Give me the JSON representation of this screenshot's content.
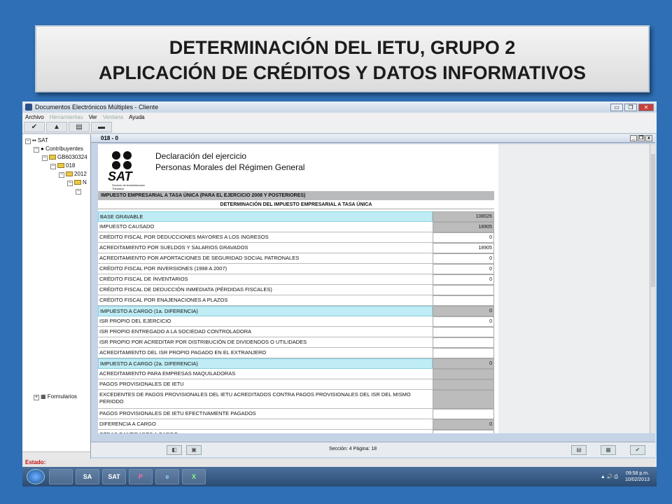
{
  "slide": {
    "title_line1": "DETERMINACIÓN DEL IETU, GRUPO 2",
    "title_line2": "APLICACIÓN DE CRÉDITOS Y DATOS INFORMATIVOS"
  },
  "window": {
    "title": "Documentos Electrónicos Múltiples - Cliente",
    "buttons": [
      "▭",
      "❐",
      "✕"
    ]
  },
  "menu": {
    "archivo": "Archivo",
    "herramientas": "Herramientas",
    "ver": "Ver",
    "ventana": "Ventana",
    "ayuda": "Ayuda"
  },
  "tree": {
    "root": "SAT",
    "contribuyentes": "Contribuyentes",
    "rfc": "GB6030324",
    "n018": "018",
    "year": "2012",
    "sub": "N",
    "formularios": "Formularios"
  },
  "doc": {
    "tab_title": "018 - 0",
    "ctrls": [
      "_",
      "❐",
      "x"
    ],
    "heading1": "Declaración del ejercicio",
    "heading2": "Personas Morales del Régimen General",
    "logo_word": "SAT",
    "logo_sub": "Servicio de Administración Tributaria",
    "section_header": "IMPUESTO EMPRESARIAL A TASA ÚNICA (PARA EL EJERCICIO 2008 Y POSTERIORES)",
    "subsection_header": "DETERMINACIÓN DEL IMPUESTO EMPRESARIAL A TASA ÚNICA",
    "rows": [
      {
        "label": "BASE GRAVABLE",
        "value": "108026"
      },
      {
        "label": "IMPUESTO CAUSADO",
        "value": "18905"
      },
      {
        "label": "CRÉDITO FISCAL POR DEDUCCIONES MAYORES A LOS INGRESOS",
        "value": "0"
      },
      {
        "label": "ACREDITAMIENTO POR SUELDOS Y SALARIOS GRAVADOS",
        "value": "18905"
      },
      {
        "label": "ACREDITAMIENTO POR APORTACIONES DE SEGURIDAD SOCIAL PATRONALES",
        "value": "0"
      },
      {
        "label": "CRÉDITO FISCAL POR INVERSIONES (1998 A 2007)",
        "value": "0"
      },
      {
        "label": "CRÉDITO FISCAL DE INVENTARIOS",
        "value": "0"
      },
      {
        "label": "CRÉDITO FISCAL DE DEDUCCIÓN INMEDIATA (PÉRDIDAS FISCALES)",
        "value": ""
      },
      {
        "label": "CRÉDITO FISCAL POR ENAJENACIONES A PLAZOS",
        "value": ""
      },
      {
        "label": "IMPUESTO A CARGO (1a. DIFERENCIA)",
        "value": "0"
      },
      {
        "label": "ISR PROPIO DEL EJERCICIO",
        "value": "0"
      },
      {
        "label": "ISR PROPIO ENTREGADO A LA SOCIEDAD CONTROLADORA",
        "value": ""
      },
      {
        "label": "ISR PROPIO POR ACREDITAR POR DISTRIBUCIÓN DE DIVIDENDOS O UTILIDADES",
        "value": ""
      },
      {
        "label": "ACREDITAMIENTO DEL ISR PROPIO PAGADO EN EL EXTRANJERO",
        "value": ""
      },
      {
        "label": "IMPUESTO A CARGO (2a. DIFERENCIA)",
        "value": "0"
      },
      {
        "label": "ACREDITAMIENTO PARA EMPRESAS MAQUILADORAS",
        "value": ""
      },
      {
        "label": "PAGOS PROVISIONALES DE IETU",
        "value": ""
      },
      {
        "label": "EXCEDENTES DE PAGOS PROVISIONALES DEL IETU ACREDITADOS CONTRA PAGOS PROVISIONALES DEL ISR DEL MISMO PERIODO",
        "value": ""
      },
      {
        "label": "PAGOS PROVISIONALES DE IETU EFECTIVAMENTE PAGADOS",
        "value": ""
      },
      {
        "label": "DIFERENCIA A CARGO",
        "value": "0"
      },
      {
        "label": "OTRAS CANTIDADES A CARGO",
        "value": ""
      }
    ],
    "status_section": "Sección: 4  Página: 18"
  },
  "estado": "Estado:",
  "taskbar": {
    "apps": [
      "",
      "SA",
      "SAT",
      "P",
      "e",
      "X"
    ],
    "tray_icons": "▲ 🔊 ⎙",
    "time": "09:58 p.m.",
    "date": "10/02/2013"
  }
}
